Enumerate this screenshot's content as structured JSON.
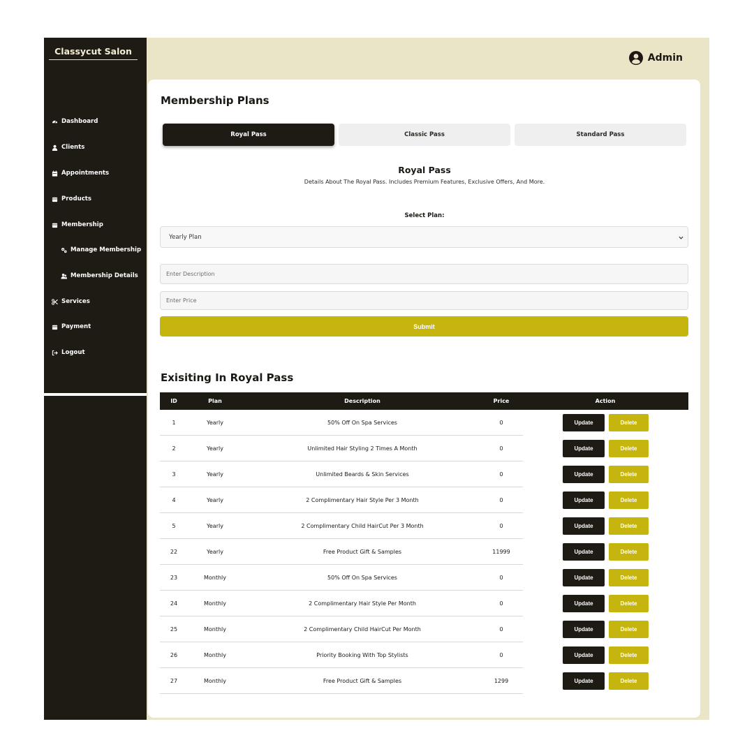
{
  "sidebar": {
    "brand": "Classycut Salon",
    "items": [
      {
        "label": "Dashboard",
        "icon": "gauge-icon"
      },
      {
        "label": "Clients",
        "icon": "user-icon"
      },
      {
        "label": "Appointments",
        "icon": "calendar-icon"
      },
      {
        "label": "Products",
        "icon": "wallet-icon"
      },
      {
        "label": "Membership",
        "icon": "wallet-icon"
      },
      {
        "label": "Manage Membership",
        "icon": "gears-icon"
      },
      {
        "label": "Membership Details",
        "icon": "users-icon"
      },
      {
        "label": "Services",
        "icon": "scissors-icon"
      },
      {
        "label": "Payment",
        "icon": "wallet-icon"
      },
      {
        "label": "Logout",
        "icon": "logout-icon"
      }
    ]
  },
  "header": {
    "user": "Admin",
    "user_icon": "user-circle-icon"
  },
  "page": {
    "title": "Membership Plans",
    "tabs": [
      "Royal Pass",
      "Classic Pass",
      "Standard Pass"
    ],
    "active_tab": "Royal Pass",
    "pass_title": "Royal Pass",
    "pass_description": "Details About The Royal Pass. Includes Premium Features, Exclusive Offers, And More.",
    "select_label": "Select Plan:",
    "select_value": "Yearly Plan",
    "description_placeholder": "Enter Description",
    "price_placeholder": "Enter Price",
    "submit_label": "Submit",
    "existing_title": "Exisiting In Royal Pass"
  },
  "table": {
    "headers": [
      "ID",
      "Plan",
      "Description",
      "Price",
      "Action"
    ],
    "update_label": "Update",
    "delete_label": "Delete",
    "rows": [
      {
        "id": "1",
        "plan": "Yearly",
        "description": "50% Off On Spa Services",
        "price": "0"
      },
      {
        "id": "2",
        "plan": "Yearly",
        "description": "Unlimited Hair Styling 2 Times A Month",
        "price": "0"
      },
      {
        "id": "3",
        "plan": "Yearly",
        "description": "Unlimited Beards & Skin Services",
        "price": "0"
      },
      {
        "id": "4",
        "plan": "Yearly",
        "description": "2 Complimentary Hair Style Per 3 Month",
        "price": "0"
      },
      {
        "id": "5",
        "plan": "Yearly",
        "description": "2 Complimentary Child HairCut Per 3 Month",
        "price": "0"
      },
      {
        "id": "22",
        "plan": "Yearly",
        "description": "Free Product Gift & Samples",
        "price": "11999"
      },
      {
        "id": "23",
        "plan": "Monthly",
        "description": "50% Off On Spa Services",
        "price": "0"
      },
      {
        "id": "24",
        "plan": "Monthly",
        "description": "2 Complimentary Hair Style Per Month",
        "price": "0"
      },
      {
        "id": "25",
        "plan": "Monthly",
        "description": "2 Complimentary Child HairCut Per Month",
        "price": "0"
      },
      {
        "id": "26",
        "plan": "Monthly",
        "description": "Priority Booking With Top Stylists",
        "price": "0"
      },
      {
        "id": "27",
        "plan": "Monthly",
        "description": "Free Product Gift & Samples",
        "price": "1299"
      }
    ]
  },
  "colors": {
    "sidebar": "#1e1a14",
    "header": "#ebe5c8",
    "accent": "#c6b50f",
    "dark_button": "#1e1a14"
  }
}
